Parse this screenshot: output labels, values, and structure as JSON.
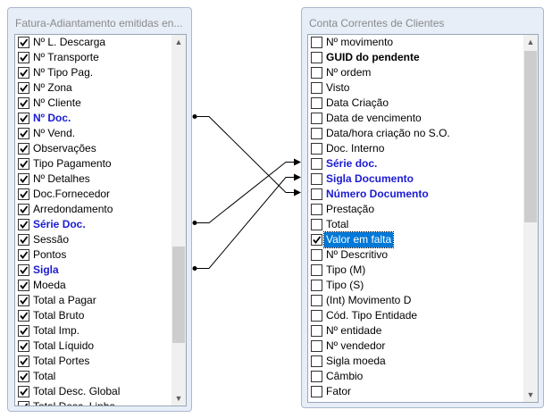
{
  "left_panel": {
    "title": "Fatura-Adiantamento emitidas en...",
    "items": [
      {
        "label": "Nº L. Descarga",
        "checked": true,
        "style": ""
      },
      {
        "label": "Nº Transporte",
        "checked": true,
        "style": ""
      },
      {
        "label": "Nº Tipo Pag.",
        "checked": true,
        "style": ""
      },
      {
        "label": "Nº Zona",
        "checked": true,
        "style": ""
      },
      {
        "label": "Nº Cliente",
        "checked": true,
        "style": ""
      },
      {
        "label": "Nº Doc.",
        "checked": true,
        "style": "blue"
      },
      {
        "label": "Nº Vend.",
        "checked": true,
        "style": ""
      },
      {
        "label": "Observações",
        "checked": true,
        "style": ""
      },
      {
        "label": "Tipo Pagamento",
        "checked": true,
        "style": ""
      },
      {
        "label": "Nº Detalhes",
        "checked": true,
        "style": ""
      },
      {
        "label": "Doc.Fornecedor",
        "checked": true,
        "style": ""
      },
      {
        "label": "Arredondamento",
        "checked": true,
        "style": ""
      },
      {
        "label": "Série Doc.",
        "checked": true,
        "style": "blue"
      },
      {
        "label": "Sessão",
        "checked": true,
        "style": ""
      },
      {
        "label": "Pontos",
        "checked": true,
        "style": ""
      },
      {
        "label": "Sigla",
        "checked": true,
        "style": "blue"
      },
      {
        "label": "Moeda",
        "checked": true,
        "style": ""
      },
      {
        "label": "Total a Pagar",
        "checked": true,
        "style": ""
      },
      {
        "label": "Total Bruto",
        "checked": true,
        "style": ""
      },
      {
        "label": "Total Imp.",
        "checked": true,
        "style": ""
      },
      {
        "label": "Total Líquido",
        "checked": true,
        "style": ""
      },
      {
        "label": "Total Portes",
        "checked": true,
        "style": ""
      },
      {
        "label": "Total",
        "checked": true,
        "style": ""
      },
      {
        "label": "Total Desc. Global",
        "checked": true,
        "style": ""
      },
      {
        "label": "Total Desc. Linha",
        "checked": true,
        "style": ""
      }
    ]
  },
  "right_panel": {
    "title": "Conta Correntes de Clientes",
    "items": [
      {
        "label": "Nº movimento",
        "checked": false,
        "style": ""
      },
      {
        "label": "GUID do pendente",
        "checked": false,
        "style": "bold"
      },
      {
        "label": "Nº ordem",
        "checked": false,
        "style": ""
      },
      {
        "label": "Visto",
        "checked": false,
        "style": ""
      },
      {
        "label": "Data Criação",
        "checked": false,
        "style": ""
      },
      {
        "label": "Data de vencimento",
        "checked": false,
        "style": ""
      },
      {
        "label": "Data/hora criação no S.O.",
        "checked": false,
        "style": ""
      },
      {
        "label": "Doc. Interno",
        "checked": false,
        "style": ""
      },
      {
        "label": "Série doc.",
        "checked": false,
        "style": "blue"
      },
      {
        "label": "Sigla Documento",
        "checked": false,
        "style": "blue"
      },
      {
        "label": "Número Documento",
        "checked": false,
        "style": "blue"
      },
      {
        "label": "Prestação",
        "checked": false,
        "style": ""
      },
      {
        "label": "Total",
        "checked": false,
        "style": ""
      },
      {
        "label": "Valor em falta",
        "checked": true,
        "style": "",
        "selected": true
      },
      {
        "label": "Nº Descritivo",
        "checked": false,
        "style": ""
      },
      {
        "label": "Tipo (M)",
        "checked": false,
        "style": ""
      },
      {
        "label": "Tipo (S)",
        "checked": false,
        "style": ""
      },
      {
        "label": "(Int) Movimento D",
        "checked": false,
        "style": ""
      },
      {
        "label": "Cód. Tipo Entidade",
        "checked": false,
        "style": ""
      },
      {
        "label": "Nº entidade",
        "checked": false,
        "style": ""
      },
      {
        "label": "Nº vendedor",
        "checked": false,
        "style": ""
      },
      {
        "label": "Sigla moeda",
        "checked": false,
        "style": ""
      },
      {
        "label": "Câmbio",
        "checked": false,
        "style": ""
      },
      {
        "label": "Fator",
        "checked": false,
        "style": ""
      }
    ]
  },
  "links": [
    {
      "from": "Nº Doc.",
      "to": "Número Documento"
    },
    {
      "from": "Série Doc.",
      "to": "Série doc."
    },
    {
      "from": "Sigla",
      "to": "Sigla Documento"
    }
  ],
  "colors": {
    "link_label": "#1b1bd2",
    "selection": "#0078d7"
  }
}
